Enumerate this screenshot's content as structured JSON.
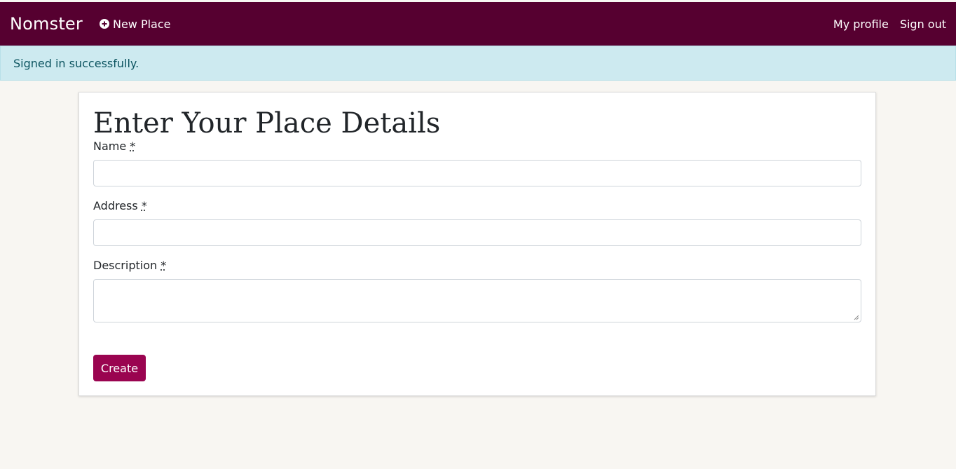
{
  "navbar": {
    "brand": "Nomster",
    "new_place_label": "New Place",
    "new_place_icon": "plus-circle-icon",
    "profile_label": "My profile",
    "signout_label": "Sign out",
    "background_color": "#560030"
  },
  "alert": {
    "message": "Signed in successfully.",
    "background_color": "#cdeaf0"
  },
  "form": {
    "title": "Enter Your Place Details",
    "fields": [
      {
        "label": "Name",
        "required_mark": "*",
        "value": "",
        "placeholder": ""
      },
      {
        "label": "Address",
        "required_mark": "*",
        "value": "",
        "placeholder": ""
      },
      {
        "label": "Description",
        "required_mark": "*",
        "value": "",
        "placeholder": ""
      }
    ],
    "submit_label": "Create",
    "submit_color": "#9a0450"
  }
}
